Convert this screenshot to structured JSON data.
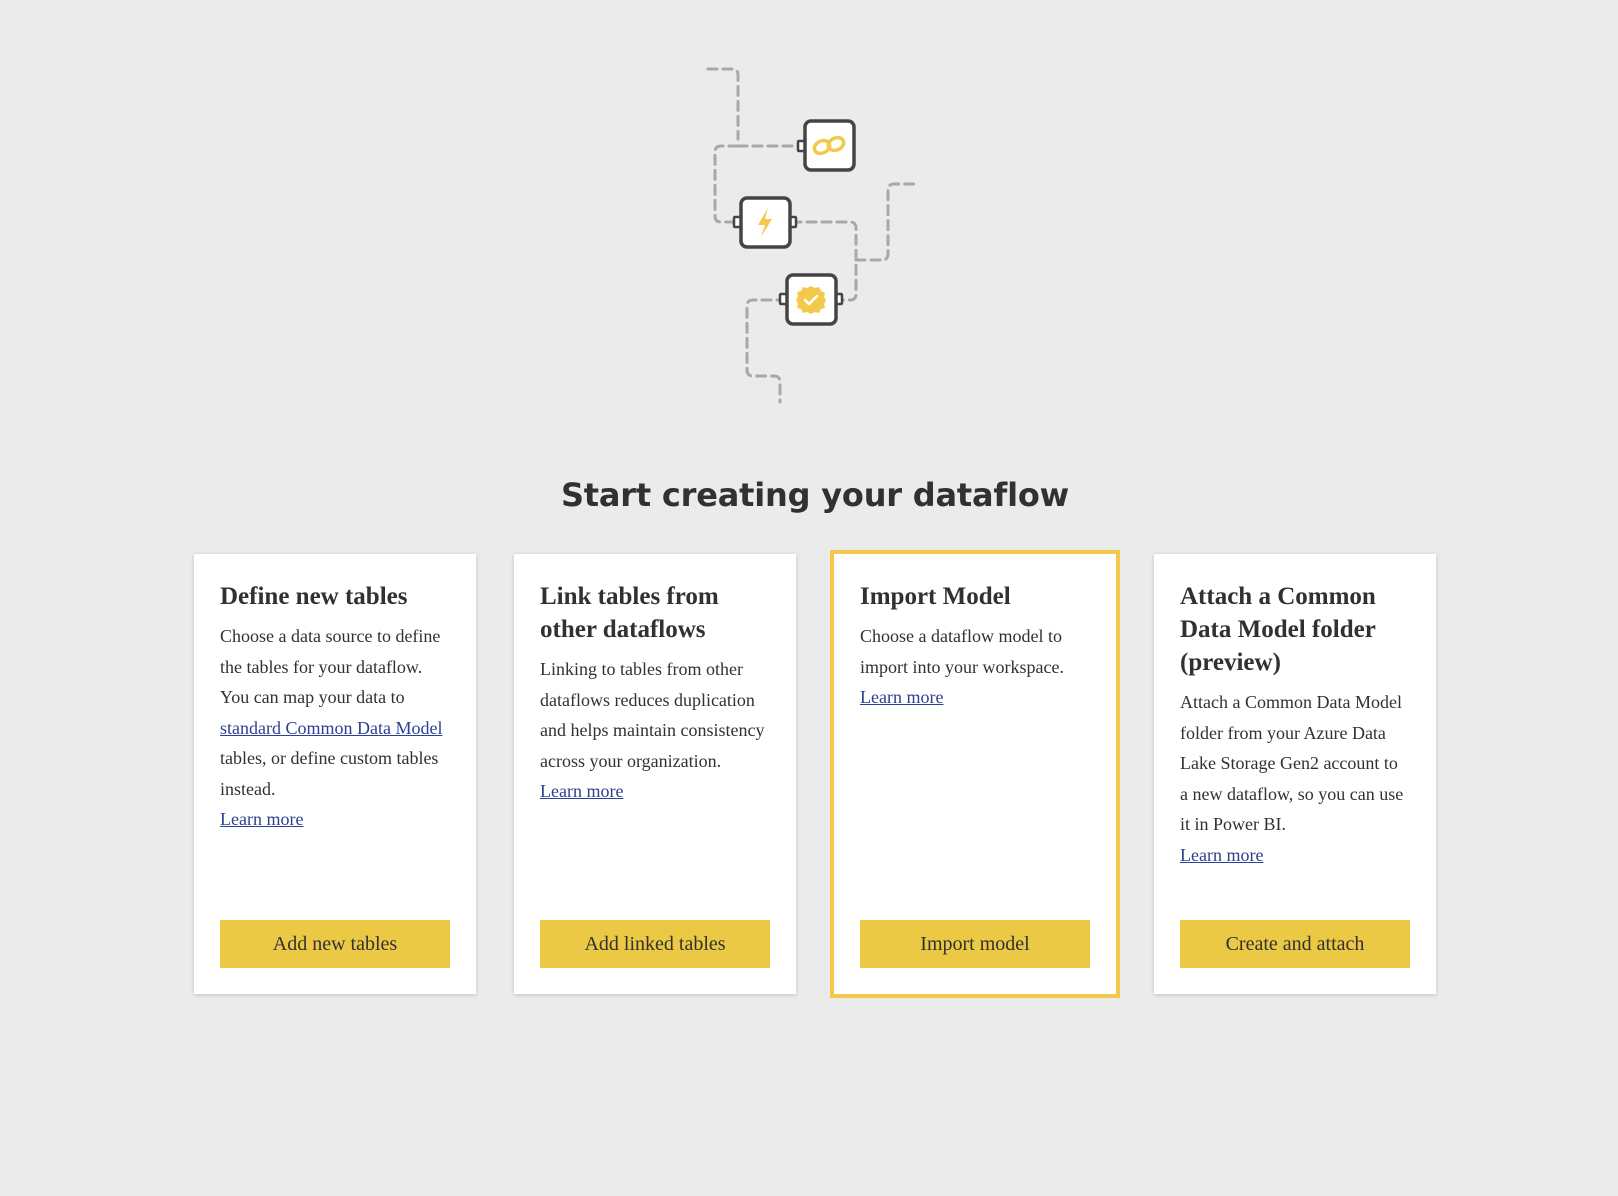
{
  "page": {
    "title": "Start creating your dataflow"
  },
  "illustration": {
    "icons": [
      "link-icon",
      "lightning-icon",
      "verified-badge-icon"
    ],
    "accent_color": "#f2c94c",
    "connector_color": "#a8a8a8"
  },
  "cards": [
    {
      "title": "Define new tables",
      "desc_before": "Choose a data source to define the tables for your dataflow. You can map your data to ",
      "desc_link": "standard Common Data Model",
      "desc_after": " tables, or define custom tables instead.",
      "learn_more": "Learn more",
      "button": "Add new tables"
    },
    {
      "title": "Link tables from other dataflows",
      "desc": "Linking to tables from other dataflows reduces duplication and helps maintain consistency across your organization.",
      "learn_more": "Learn more",
      "button": "Add linked tables"
    },
    {
      "title": "Import Model",
      "desc": "Choose a dataflow model to import into your workspace.",
      "learn_more": "Learn more",
      "button": "Import model"
    },
    {
      "title": "Attach a Common Data Model folder (preview)",
      "desc": "Attach a Common Data Model folder from your Azure Data Lake Storage Gen2 account to a new dataflow, so you can use it in Power BI.",
      "learn_more": "Learn more",
      "button": "Create and attach"
    }
  ],
  "colors": {
    "background": "#ebebeb",
    "button": "#ebc944",
    "selected_border": "#f2c94c",
    "link": "#2b3f94",
    "text": "#323130"
  }
}
